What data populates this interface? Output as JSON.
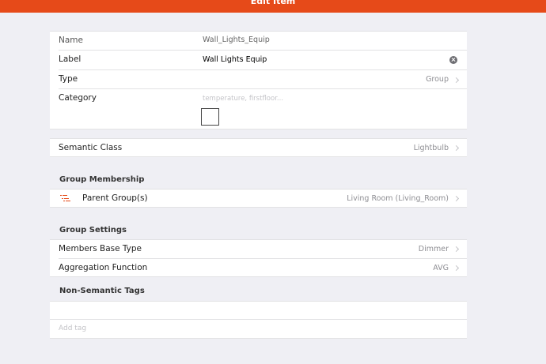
{
  "header": {
    "title": "Edit Item"
  },
  "item": {
    "name_label": "Name",
    "name_value": "Wall_Lights_Equip",
    "label_label": "Label",
    "label_value": "Wall Lights Equip",
    "type_label": "Type",
    "type_value": "Group",
    "category_label": "Category",
    "category_placeholder": "temperature, firstfloor..."
  },
  "semantic": {
    "label": "Semantic Class",
    "value": "Lightbulb"
  },
  "group_membership": {
    "title": "Group Membership",
    "parent_label": "Parent Group(s)",
    "parent_value": "Living Room (Living_Room)"
  },
  "group_settings": {
    "title": "Group Settings",
    "base_type_label": "Members Base Type",
    "base_type_value": "Dimmer",
    "aggregation_label": "Aggregation Function",
    "aggregation_value": "AVG"
  },
  "tags": {
    "title": "Non-Semantic Tags",
    "add_placeholder": "Add tag"
  },
  "colors": {
    "accent": "#e64a19",
    "background": "#efeff4"
  },
  "icons": {
    "clear": "clear-icon",
    "chevron": "chevron-right-icon",
    "list": "list-icon"
  }
}
